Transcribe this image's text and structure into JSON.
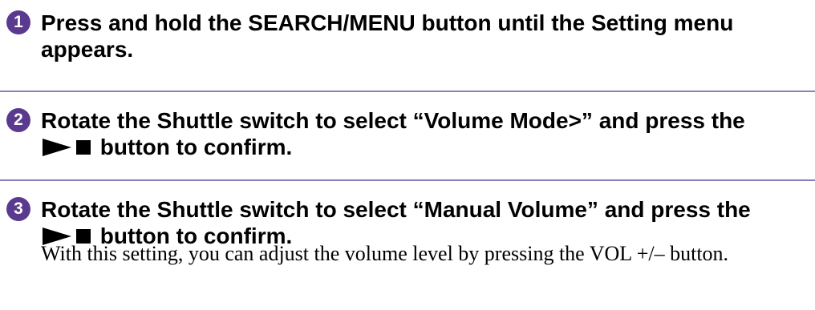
{
  "steps": [
    {
      "number": "1",
      "text": "Press and hold the SEARCH/MENU button until the Setting menu appears."
    },
    {
      "number": "2",
      "text_before": "Rotate the Shuttle switch to select “Volume Mode>” and press the",
      "text_after": "button to confirm."
    },
    {
      "number": "3",
      "text_before": "Rotate the Shuttle switch to select “Manual Volume” and press the",
      "text_after": "button to confirm.",
      "note": "With this setting, you can adjust the volume level by pressing the VOL +/– button."
    }
  ],
  "icons": {
    "play_stop": "play-stop-icon"
  },
  "colors": {
    "badge": "#5a3a8e",
    "divider": "#8a80b8",
    "text": "#000000"
  }
}
